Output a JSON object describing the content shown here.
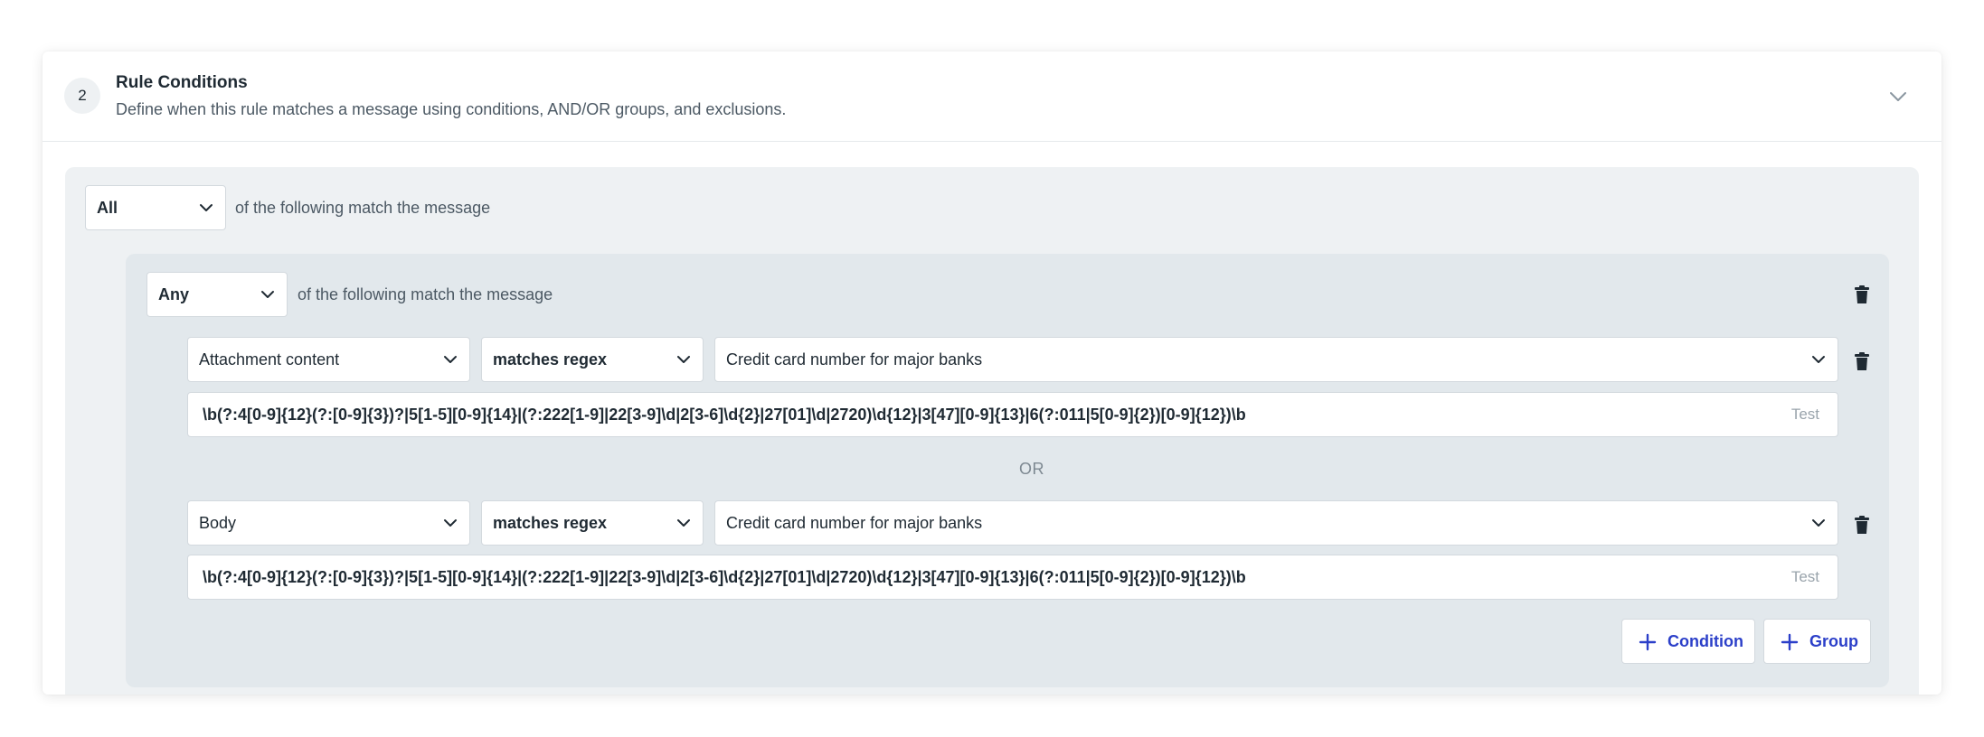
{
  "section": {
    "step_number": "2",
    "title": "Rule Conditions",
    "description": "Define when this rule matches a message using conditions, AND/OR groups, and exclusions."
  },
  "outer_group": {
    "quantifier": "All",
    "label": "of the following match the message"
  },
  "inner_group": {
    "quantifier": "Any",
    "label": "of the following match the message",
    "separator": "OR",
    "conditions": [
      {
        "field": "Attachment content",
        "operator": "matches regex",
        "pattern_name": "Credit card number for major banks",
        "regex": "\\b(?:4[0-9]{12}(?:[0-9]{3})?|5[1-5][0-9]{14}|(?:222[1-9]|22[3-9]\\d|2[3-6]\\d{2}|27[01]\\d|2720)\\d{12}|3[47][0-9]{13}|6(?:011|5[0-9]{2})[0-9]{12})\\b",
        "test_label": "Test"
      },
      {
        "field": "Body",
        "operator": "matches regex",
        "pattern_name": "Credit card number for major banks",
        "regex": "\\b(?:4[0-9]{12}(?:[0-9]{3})?|5[1-5][0-9]{14}|(?:222[1-9]|22[3-9]\\d|2[3-6]\\d{2}|27[01]\\d|2720)\\d{12}|3[47][0-9]{13}|6(?:011|5[0-9]{2})[0-9]{12})\\b",
        "test_label": "Test"
      }
    ]
  },
  "actions": {
    "add_condition_label": "Condition",
    "add_group_label": "Group"
  },
  "icons": {
    "collapse": "chevron-down-icon",
    "delete": "trash-icon",
    "add": "plus-icon"
  },
  "colors": {
    "accent": "#2b3fc9",
    "outer_group_bg": "#eef1f3",
    "inner_group_bg": "#e2e8ec"
  }
}
